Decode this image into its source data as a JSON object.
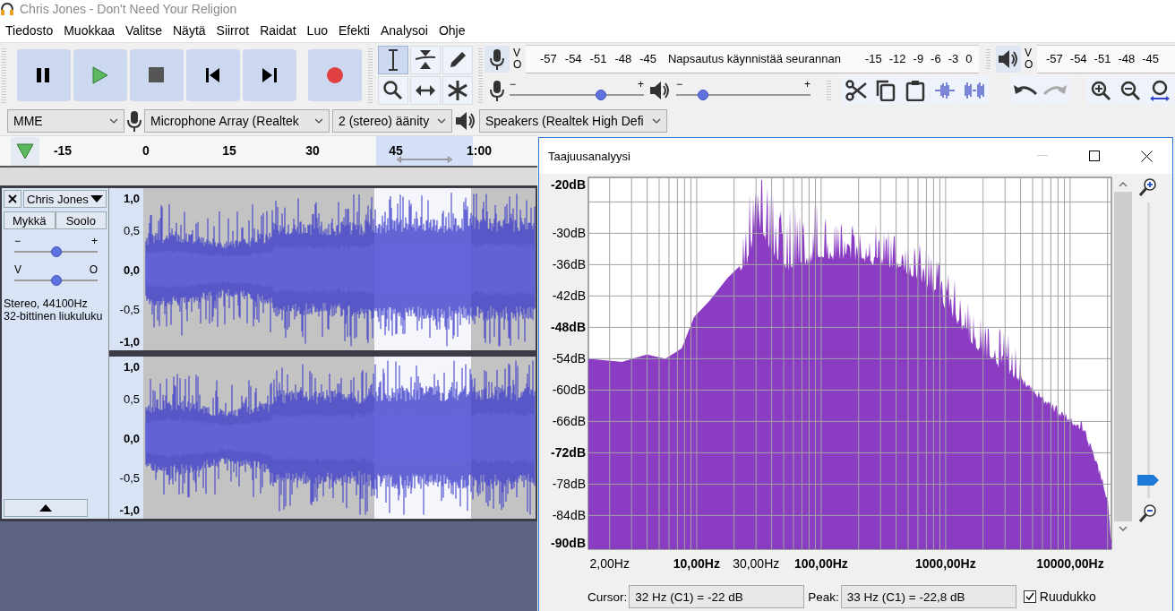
{
  "window": {
    "title": "Chris Jones - Don't Need Your Religion"
  },
  "menu": [
    "Tiedosto",
    "Muokkaa",
    "Valitse",
    "Näytä",
    "Siirrot",
    "Raidat",
    "Luo",
    "Efekti",
    "Analysoi",
    "Ohje"
  ],
  "tools": [
    {
      "kind": "select",
      "selected": true
    },
    {
      "kind": "envelope",
      "selected": false
    },
    {
      "kind": "draw",
      "selected": false
    },
    {
      "kind": "zoom",
      "selected": false
    },
    {
      "kind": "timeshift",
      "selected": false
    },
    {
      "kind": "multi",
      "selected": false
    }
  ],
  "record_meter": {
    "labels": [
      "V",
      "O"
    ],
    "scale": [
      "-57",
      "-54",
      "-51",
      "-48",
      "-45"
    ],
    "hint": "Napsautus käynnistää seurannan",
    "scale_end": [
      "-15",
      "-12",
      "-9",
      "-6",
      "-3",
      "0"
    ]
  },
  "playback_meter": {
    "labels": [
      "V",
      "O"
    ],
    "scale": [
      "-57",
      "-54",
      "-51",
      "-48",
      "-45"
    ]
  },
  "mixer": {
    "record": {
      "min": "−",
      "max": "+",
      "level": 0.68
    },
    "playback": {
      "min": "−",
      "max": "+",
      "level": 0.2
    }
  },
  "devices": {
    "host": "MME",
    "input": "Microphone Array (Realtek",
    "channels": "2 (stereo) äänity",
    "output": "Speakers (Realtek High Defi"
  },
  "timeline": {
    "ticks": [
      "-15",
      "0",
      "15",
      "30",
      "45",
      "1:00"
    ]
  },
  "track": {
    "name": "Chris Jones",
    "mute": "Mykkä",
    "solo": "Soolo",
    "gain": {
      "min": "−",
      "max": "+",
      "level": 0.5
    },
    "pan": {
      "left": "V",
      "right": "O",
      "level": 0.5
    },
    "info": [
      "Stereo, 44100Hz",
      "32-bittinen liukuluku"
    ],
    "channels": [
      {
        "ruler": [
          "1,0",
          "0,5",
          "0,0",
          "-0,5",
          "-1,0"
        ]
      },
      {
        "ruler": [
          "1,0",
          "0,5",
          "0,0",
          "-0,5",
          "-1,0"
        ]
      }
    ]
  },
  "analysis": {
    "title": "Taajuusanalyysi",
    "y_labels": [
      {
        "text": "-20dB",
        "major": true
      },
      {
        "text": "-30dB",
        "major": false
      },
      {
        "text": "-36dB",
        "major": false
      },
      {
        "text": "-42dB",
        "major": false
      },
      {
        "text": "-48dB",
        "major": true
      },
      {
        "text": "-54dB",
        "major": false
      },
      {
        "text": "-60dB",
        "major": false
      },
      {
        "text": "-66dB",
        "major": false
      },
      {
        "text": "-72dB",
        "major": true
      },
      {
        "text": "-78dB",
        "major": false
      },
      {
        "text": "-84dB",
        "major": false
      },
      {
        "text": "-90dB",
        "major": true
      }
    ],
    "x_labels": [
      {
        "text": "2,00Hz",
        "major": false
      },
      {
        "text": "10,00Hz",
        "major": true
      },
      {
        "text": "30,00Hz",
        "major": false
      },
      {
        "text": "100,00Hz",
        "major": true
      },
      {
        "text": "1000,00Hz",
        "major": true
      },
      {
        "text": "10000,00Hz",
        "major": true
      }
    ],
    "zoom": {
      "level": 0.06
    },
    "cursor_label": "Cursor:",
    "cursor": "32 Hz (C1) = -22 dB",
    "peak_label": "Peak:",
    "peak": "33 Hz (C1) = -22,8 dB",
    "grid": {
      "label": "Ruudukko",
      "checked": true
    }
  }
}
